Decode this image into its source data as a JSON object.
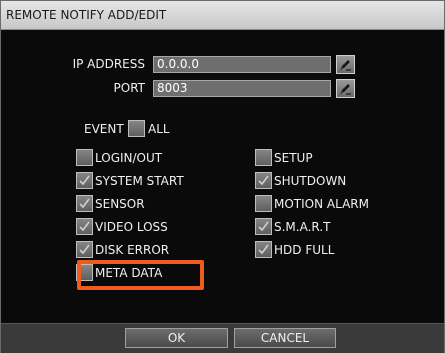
{
  "dialog": {
    "title": "REMOTE NOTIFY ADD/EDIT"
  },
  "ip": {
    "label": "IP ADDRESS",
    "value": "0.0.0.0"
  },
  "port": {
    "label": "PORT",
    "value": "8003"
  },
  "event": {
    "label": "EVENT",
    "all_label": "ALL",
    "all_checked": false
  },
  "events_left": [
    {
      "label": "LOGIN/OUT",
      "checked": false
    },
    {
      "label": "SYSTEM START",
      "checked": true
    },
    {
      "label": "SENSOR",
      "checked": true
    },
    {
      "label": "VIDEO LOSS",
      "checked": true
    },
    {
      "label": "DISK ERROR",
      "checked": true
    },
    {
      "label": "META DATA",
      "checked": false
    }
  ],
  "events_right": [
    {
      "label": "SETUP",
      "checked": false
    },
    {
      "label": "SHUTDOWN",
      "checked": true
    },
    {
      "label": "MOTION ALARM",
      "checked": false
    },
    {
      "label": "S.M.A.R.T",
      "checked": true
    },
    {
      "label": "HDD FULL",
      "checked": true
    }
  ],
  "buttons": {
    "ok": "OK",
    "cancel": "CANCEL"
  },
  "colors": {
    "highlight": "#ef5a1f",
    "titlebar": "#d8d8d8",
    "background": "#0a0a0a"
  },
  "icons": {
    "edit_button": "pencil-keyboard-icon",
    "check": "check-icon"
  }
}
